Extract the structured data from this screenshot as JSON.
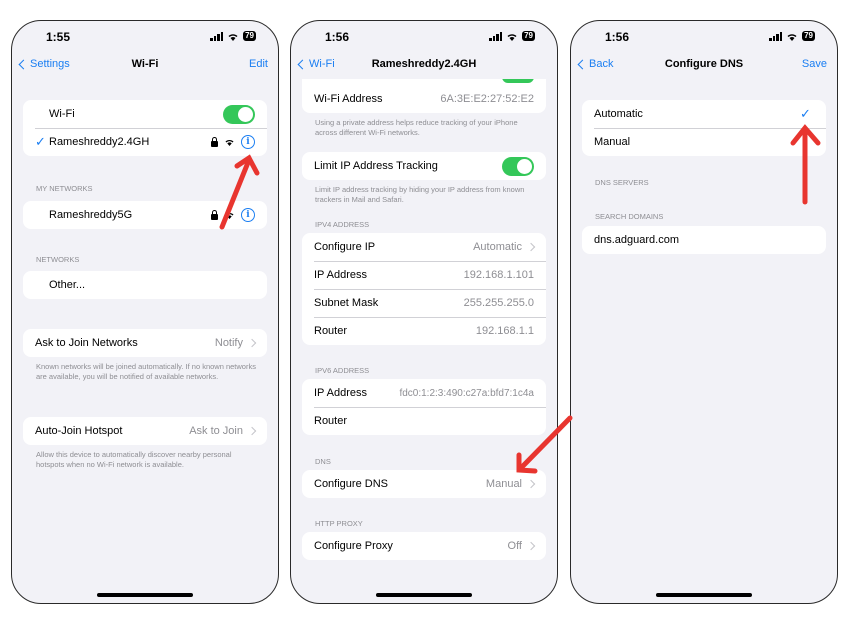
{
  "status": {
    "time_1": "1:55",
    "time_2": "1:56",
    "time_3": "1:56",
    "battery": "79"
  },
  "colors": {
    "accent": "#1a7ef2",
    "toggle_on": "#34c759",
    "annotation_arrow": "#e8352f"
  },
  "screen1": {
    "nav": {
      "back": "Settings",
      "title": "Wi-Fi",
      "right": "Edit"
    },
    "wifi_label": "Wi-Fi",
    "connected": "Rameshreddy2.4GH",
    "my_networks_header": "MY NETWORKS",
    "my_network": "Rameshreddy5G",
    "networks_header": "NETWORKS",
    "other": "Other...",
    "ask_join_label": "Ask to Join Networks",
    "ask_join_value": "Notify",
    "ask_join_footer": "Known networks will be joined automatically. If no known networks are available, you will be notified of available networks.",
    "auto_join_label": "Auto-Join Hotspot",
    "auto_join_value": "Ask to Join",
    "auto_join_footer": "Allow this device to automatically discover nearby personal hotspots when no Wi-Fi network is available."
  },
  "screen2": {
    "nav": {
      "back": "Wi-Fi",
      "title": "Rameshreddy2.4GH"
    },
    "wifi_address_label": "Wi-Fi Address",
    "wifi_address_value": "6A:3E:E2:27:52:E2",
    "private_footer": "Using a private address helps reduce tracking of your iPhone across different Wi-Fi networks.",
    "limit_ip_label": "Limit IP Address Tracking",
    "limit_ip_footer": "Limit IP address tracking by hiding your IP address from known trackers in Mail and Safari.",
    "ipv4_header": "IPV4 ADDRESS",
    "ipv4_rows": [
      {
        "label": "Configure IP",
        "value": "Automatic"
      },
      {
        "label": "IP Address",
        "value": "192.168.1.101"
      },
      {
        "label": "Subnet Mask",
        "value": "255.255.255.0"
      },
      {
        "label": "Router",
        "value": "192.168.1.1"
      }
    ],
    "ipv6_header": "IPV6 ADDRESS",
    "ipv6_ip_label": "IP Address",
    "ipv6_ip_value": "fdc0:1:2:3:490:c27a:bfd7:1c4a",
    "ipv6_router_label": "Router",
    "dns_header": "DNS",
    "configure_dns_label": "Configure DNS",
    "configure_dns_value": "Manual",
    "proxy_header": "HTTP PROXY",
    "configure_proxy_label": "Configure Proxy",
    "configure_proxy_value": "Off"
  },
  "screen3": {
    "nav": {
      "back": "Back",
      "title": "Configure DNS",
      "right": "Save"
    },
    "automatic": "Automatic",
    "manual": "Manual",
    "dns_servers_header": "DNS SERVERS",
    "search_domains_header": "SEARCH DOMAINS",
    "search_domain": "dns.adguard.com"
  }
}
